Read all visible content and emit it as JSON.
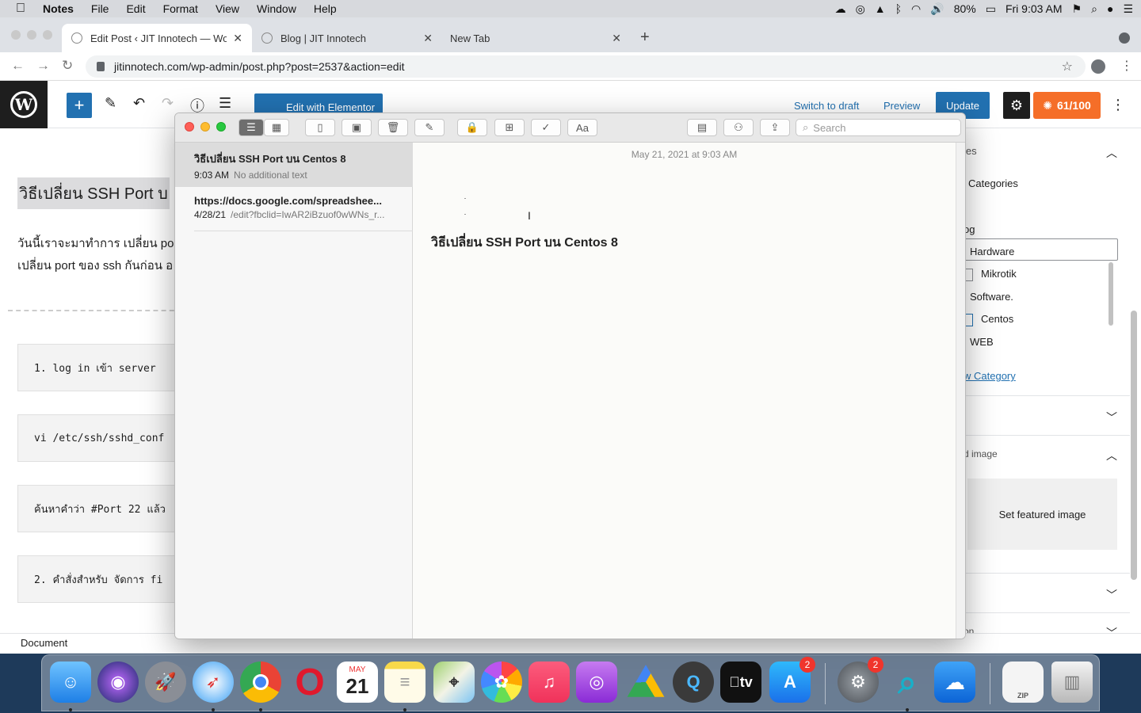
{
  "menubar": {
    "app_name": "Notes",
    "items": [
      "File",
      "Edit",
      "Format",
      "View",
      "Window",
      "Help"
    ],
    "battery": "80%",
    "clock": "Fri 9:03 AM"
  },
  "browser": {
    "tabs": [
      {
        "title": "Edit Post ‹ JIT Innotech — Wor"
      },
      {
        "title": "Blog | JIT Innotech"
      },
      {
        "title": "New Tab"
      }
    ],
    "url": "jitinnotech.com/wp-admin/post.php?post=2537&action=edit"
  },
  "wp": {
    "elementor_label": "Edit with Elementor",
    "switch_draft": "Switch to draft",
    "preview": "Preview",
    "update": "Update",
    "score": "61/100",
    "post_title": "วิธีเปลี่ยน  SSH Port บ",
    "para_line1": "วันนี้เราจะมาทำการ เปลี่ยน po",
    "para_line2": "เปลี่ยน port ของ ssh กันก่อน อ",
    "code_blocks": [
      "1. log in เข้า server",
      "vi /etc/ssh/sshd_conf",
      "ค้นหาคำว่า #Port 22 แล้ว",
      "2. คำสั่งสำหรับ จัดการ fi"
    ],
    "footer_label": "Document",
    "sidebar": {
      "section_partial": "ies",
      "categories_label": "Categories",
      "categories": [
        "og",
        "Hardware",
        "Mikrotik",
        "Software.",
        "Centos",
        "WEB"
      ],
      "new_category_link": "w Category",
      "featured_partial": "d image",
      "set_featured": "Set featured image",
      "bottom_partial": "on"
    }
  },
  "notes": {
    "search_placeholder": "Search",
    "list": [
      {
        "title": "วิธีเปลี่ยน SSH Port บน Centos 8",
        "time": "9:03 AM",
        "preview": "No additional text"
      },
      {
        "title": "https://docs.google.com/spreadshee...",
        "time": "4/28/21",
        "preview": "/edit?fbclid=IwAR2iBzuof0wWNs_r..."
      }
    ],
    "editor_date": "May 21, 2021 at 9:03 AM",
    "editor_heading": "วิธีเปลี่ยน  SSH Port บน Centos 8"
  },
  "dock": {
    "calendar_month": "MAY",
    "calendar_day": "21",
    "appstore_badge": "2",
    "prefs_badge": "2",
    "tv_label": "tv",
    "zip_label": "ZIP"
  }
}
